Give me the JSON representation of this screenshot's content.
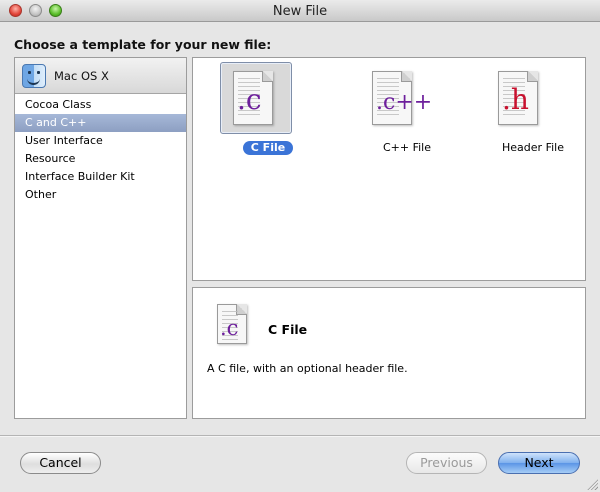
{
  "window": {
    "title": "New File"
  },
  "heading": "Choose a template for your new file:",
  "sidebar": {
    "category": {
      "label": "Mac OS X",
      "icon": "finder-icon"
    },
    "items": [
      {
        "label": "Cocoa Class",
        "selected": false
      },
      {
        "label": "C and C++",
        "selected": true
      },
      {
        "label": "User Interface",
        "selected": false
      },
      {
        "label": "Resource",
        "selected": false
      },
      {
        "label": "Interface Builder Kit",
        "selected": false
      },
      {
        "label": "Other",
        "selected": false
      }
    ]
  },
  "templates": [
    {
      "label": "C File",
      "ext": ".c",
      "ext_color": "#6d1f9c",
      "selected": true,
      "icon": "c-file-icon"
    },
    {
      "label": "C++ File",
      "ext": ".c++",
      "ext_color": "#6d1f9c",
      "selected": false,
      "icon": "cpp-file-icon"
    },
    {
      "label": "Header File",
      "ext": ".h",
      "ext_color": "#c8102e",
      "selected": false,
      "icon": "header-file-icon"
    }
  ],
  "description": {
    "title": "C File",
    "ext": ".c",
    "text": "A C file, with an optional header file."
  },
  "buttons": {
    "cancel": "Cancel",
    "previous": "Previous",
    "next": "Next"
  },
  "colors": {
    "selection_blue": "#3b74d7",
    "sidebar_selection": "#8d9fc2",
    "c_purple": "#6d1f9c",
    "h_red": "#c8102e"
  }
}
